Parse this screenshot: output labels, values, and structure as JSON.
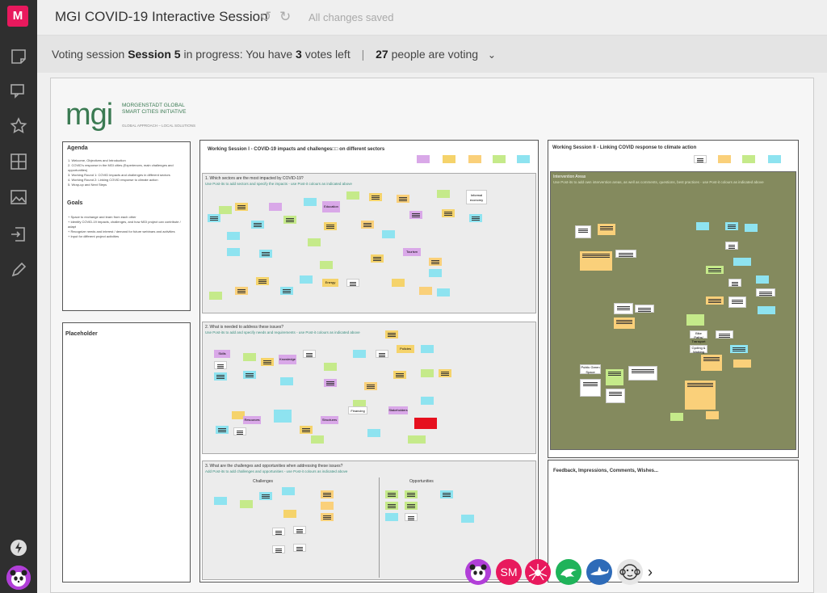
{
  "app": {
    "title": "MGI COVID-19 Interactive Session",
    "save_status": "All changes saved",
    "logo_letter": "M"
  },
  "voting": {
    "label_prefix": "Voting session",
    "session": "Session 5",
    "label_mid": "in progress: You have",
    "votes": "3",
    "label_suffix": "votes left",
    "people_count": "27",
    "people_label": "people are voting"
  },
  "board": {
    "logo_word": "mgi",
    "logo_line1": "MORGENSTADT GLOBAL SMART CITIES INITIATIVE",
    "logo_line2": "GLOBAL APPROACH – LOCAL SOLUTIONS",
    "agenda": {
      "title": "Agenda",
      "items": [
        "1.  Welcome, Objectives and Introduction",
        "2.  COVID's response in the MGI cities (Experiences, main challenges and opportunities)",
        "3.  Working Round 1: COVID impacts and challenges in different sectors",
        "4.  Working Round 2: Linking COVID response to climate action",
        "5.  Wrap-up and Next Steps"
      ],
      "goals_title": "Goals",
      "goals": [
        "+ Space to exchange and learn from each other",
        "+ Identify COVID-19 impacts, challenges, and how MGI project can contribute / adapt",
        "+ Recognize needs and interest / demand for future webinars and activities",
        "+ Input for different project activities"
      ]
    },
    "placeholder_title": "Placeholder",
    "ws1": {
      "title": "Working Session I - COVID-19 impacts and challenges□□ on different sectors",
      "q1": "1. Which sectors are the most impacted by COVID-19?",
      "q1_sub": "Use Post-its to add sectors and specify the impacts - use Post-it colours as indicated above",
      "q2": "2. What is needed to address these issues?",
      "q2_sub": "Use Post-its to add  and specify needs and requirements - use Post-it colours as indicated above",
      "q3": "3. What are the challenges and opportunities when addressing these issues?",
      "q3_sub": "Add Post-its to add challenges and opportunities - use Post-it colours as indicated above",
      "challenges": "Challenges",
      "opportunities": "Opportunities",
      "labels": [
        "Education",
        "Informal economy",
        "Tourism",
        "Energy",
        "Knowledge",
        "Structures",
        "Resources",
        "Skills",
        "Policies",
        "Stakeholders",
        "Financing"
      ]
    },
    "ws2": {
      "title": "Working Session II - Linking COVID response to climate action",
      "intervention_title": "Intervention Areas",
      "intervention_sub": "Use Post-its to add own intervention areas, as well as comments, questions, best practices - use Post-it colours as indicated above",
      "labels": [
        "Public Green Space",
        "Bike Paths/ Transport",
        "Cycling & Walking"
      ],
      "feedback_title": "Feedback, Impressions, Comments, Wishes..."
    }
  },
  "collaborators": [
    {
      "initials": "",
      "icon": "panda-icon",
      "color": "#b13fd8"
    },
    {
      "initials": "SM",
      "icon": "",
      "color": "#e8195d"
    },
    {
      "initials": "",
      "icon": "spider-icon",
      "color": "#e8195d"
    },
    {
      "initials": "",
      "icon": "dolphin-icon",
      "color": "#1fb35a"
    },
    {
      "initials": "",
      "icon": "shark-icon",
      "color": "#2e6bb8"
    },
    {
      "initials": "",
      "icon": "monkey-icon",
      "color": "#e6e6e6"
    }
  ],
  "colors": {
    "brand": "#e8195d",
    "sidebar": "#2f2f2f",
    "intervention_bg": "#848a5e"
  }
}
